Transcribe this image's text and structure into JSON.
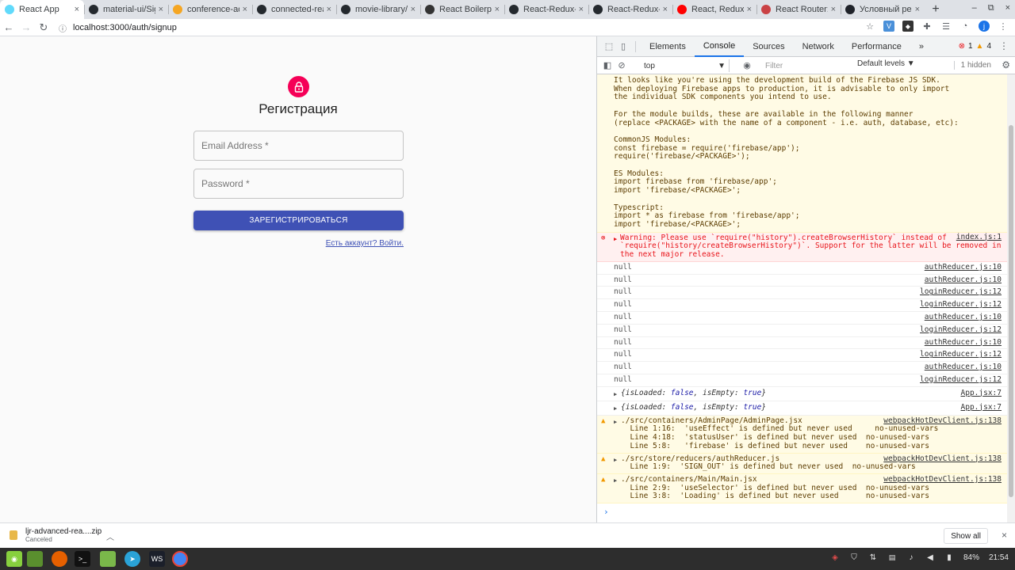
{
  "browser": {
    "tabs": [
      {
        "title": "React App",
        "favicon_color": "#61dafb",
        "active": true
      },
      {
        "title": "material-ui/Sign",
        "favicon_color": "#24292e",
        "active": false
      },
      {
        "title": "conference-adm",
        "favicon_color": "#f5a623",
        "active": false
      },
      {
        "title": "connected-react",
        "favicon_color": "#24292e",
        "active": false
      },
      {
        "title": "movie-library/ap",
        "favicon_color": "#24292e",
        "active": false
      },
      {
        "title": "React Boilerplat",
        "favicon_color": "#333333",
        "active": false
      },
      {
        "title": "React-Redux-Fir",
        "favicon_color": "#24292e",
        "active": false
      },
      {
        "title": "React-Redux-Fir",
        "favicon_color": "#24292e",
        "active": false
      },
      {
        "title": "React, Redux & F",
        "favicon_color": "#ff0000",
        "active": false
      },
      {
        "title": "React Router: De",
        "favicon_color": "#ca4245",
        "active": false
      },
      {
        "title": "Условный ренде",
        "favicon_color": "#20232a",
        "active": false
      }
    ],
    "new_tab": "+",
    "window_controls": [
      "–",
      "⧉",
      "×"
    ],
    "url": "localhost:3000/auth/signup"
  },
  "page": {
    "heading": "Регистрация",
    "email_label": "Email Address *",
    "password_label": "Password *",
    "submit_label": "ЗАРЕГИСТРИРОВАТЬСЯ",
    "signin_link": "Есть аккаунт? Войти.",
    "accent_color": "#3f51b5",
    "lock_color": "#f50057"
  },
  "devtools": {
    "tabs": [
      "Elements",
      "Console",
      "Sources",
      "Network",
      "Performance"
    ],
    "active_tab": "Console",
    "more": "»",
    "error_count": "1",
    "warning_count": "4",
    "context": "top",
    "filter_placeholder": "Filter",
    "levels": "Default levels ▼",
    "hidden": "1 hidden",
    "messages": {
      "firebase": "It looks like you're using the development build of the Firebase JS SDK.\nWhen deploying Firebase apps to production, it is advisable to only import\nthe individual SDK components you intend to use.\n\nFor the module builds, these are available in the following manner\n(replace <PACKAGE> with the name of a component - i.e. auth, database, etc):\n\nCommonJS Modules:\nconst firebase = require('firebase/app');\nrequire('firebase/<PACKAGE>');\n\nES Modules:\nimport firebase from 'firebase/app';\nimport 'firebase/<PACKAGE>';\n\nTypescript:\nimport * as firebase from 'firebase/app';\nimport 'firebase/<PACKAGE>';",
      "history_warning": "Warning: Please use `require(\"history\").createBrowserHistory` instead of\n`require(\"history/createBrowserHistory\")`. Support for the latter will be removed in\nthe next major release.",
      "history_src": "index.js:1",
      "logs": [
        {
          "text": "null",
          "src": "authReducer.js:10"
        },
        {
          "text": "null",
          "src": "authReducer.js:10"
        },
        {
          "text": "null",
          "src": "loginReducer.js:12"
        },
        {
          "text": "null",
          "src": "loginReducer.js:12"
        },
        {
          "text": "null",
          "src": "authReducer.js:10"
        },
        {
          "text": "null",
          "src": "loginReducer.js:12"
        },
        {
          "text": "null",
          "src": "authReducer.js:10"
        },
        {
          "text": "null",
          "src": "loginReducer.js:12"
        },
        {
          "text": "null",
          "src": "authReducer.js:10"
        },
        {
          "text": "null",
          "src": "loginReducer.js:12"
        }
      ],
      "objects": [
        {
          "prefix": "{isLoaded: ",
          "v1": "false",
          "mid": ", isEmpty: ",
          "v2": "true",
          "suffix": "}",
          "src": "App.jsx:7"
        },
        {
          "prefix": "{isLoaded: ",
          "v1": "false",
          "mid": ", isEmpty: ",
          "v2": "true",
          "suffix": "}",
          "src": "App.jsx:7"
        }
      ],
      "warnings": [
        {
          "text": "./src/containers/AdminPage/AdminPage.jsx\n  Line 1:16:  'useEffect' is defined but never used     no-unused-vars\n  Line 4:18:  'statusUser' is defined but never used  no-unused-vars\n  Line 5:8:   'firebase' is defined but never used    no-unused-vars",
          "src": "webpackHotDevClient.js:138"
        },
        {
          "text": "./src/store/reducers/authReducer.js\n  Line 1:9:  'SIGN_OUT' is defined but never used  no-unused-vars",
          "src": "webpackHotDevClient.js:138"
        },
        {
          "text": "./src/containers/Main/Main.jsx\n  Line 2:9:  'useSelector' is defined but never used  no-unused-vars\n  Line 3:8:  'Loading' is defined but never used      no-unused-vars",
          "src": "webpackHotDevClient.js:138"
        }
      ],
      "prompt": "›"
    }
  },
  "download": {
    "name": "ljr-advanced-rea....zip",
    "status": "Canceled",
    "show_all": "Show all"
  },
  "taskbar": {
    "battery": "84%",
    "time": "21:54"
  }
}
